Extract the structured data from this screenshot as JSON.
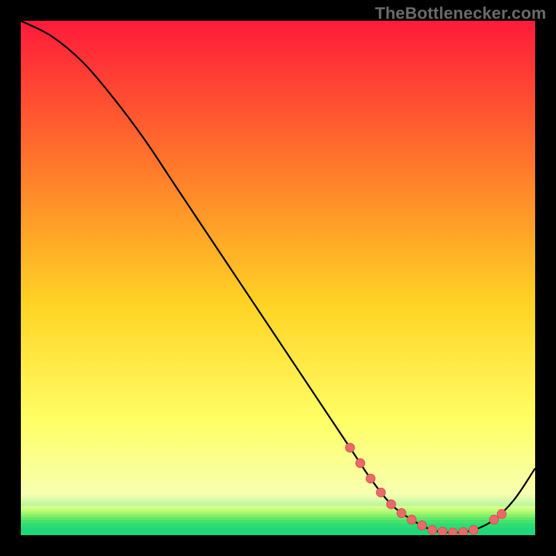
{
  "watermark": "TheBottlenecker.com",
  "plot": {
    "bg_top_color": "#ff1a3a",
    "bg_mid_upper_color": "#ff7e2a",
    "bg_mid_color": "#ffd324",
    "bg_mid_lower_color": "#ffff66",
    "bg_lower_color": "#f7ffb0",
    "bg_bottom_color": "#1fe07a",
    "curve_color": "#000000",
    "marker_fill": "#e86a6a",
    "marker_stroke": "#d94c4c"
  },
  "chart_data": {
    "type": "line",
    "title": "",
    "xlabel": "",
    "ylabel": "",
    "xlim": [
      0,
      100
    ],
    "ylim": [
      0,
      100
    ],
    "series": [
      {
        "name": "curve",
        "x": [
          0,
          6,
          12,
          18,
          24,
          30,
          36,
          42,
          48,
          54,
          60,
          64,
          68,
          72,
          76,
          80,
          84,
          88,
          92,
          96,
          100
        ],
        "y": [
          100,
          97,
          92,
          85,
          77,
          68,
          59,
          50,
          41,
          32,
          23,
          17,
          11,
          6,
          3,
          1,
          0.5,
          1,
          3,
          7,
          13
        ]
      }
    ],
    "markers": {
      "x": [
        64,
        66,
        68,
        70,
        72,
        74,
        76,
        78,
        80,
        82,
        84,
        86,
        88,
        92,
        93.5
      ],
      "y": [
        17,
        14,
        11,
        8.3,
        6,
        4.3,
        3,
        1.9,
        1,
        0.7,
        0.5,
        0.6,
        1,
        3,
        4.1
      ]
    }
  }
}
